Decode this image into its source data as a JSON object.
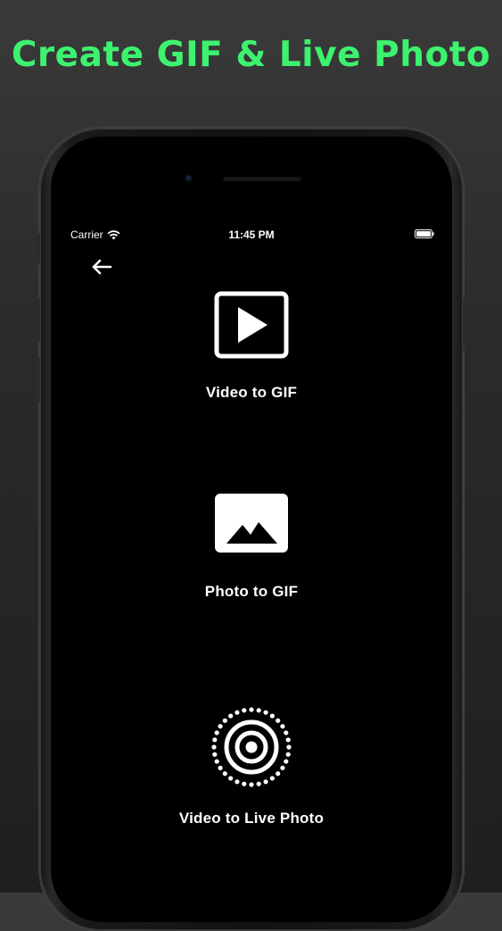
{
  "headline": "Create GIF & Live Photo",
  "status_bar": {
    "carrier": "Carrier",
    "time": "11:45 PM"
  },
  "options": [
    {
      "label": "Video to GIF",
      "icon": "video-play-icon"
    },
    {
      "label": "Photo to GIF",
      "icon": "photo-mountain-icon"
    },
    {
      "label": "Video to Live Photo",
      "icon": "live-photo-icon"
    }
  ],
  "colors": {
    "headline": "#3df26e",
    "screen_background": "#000000",
    "text": "#ffffff"
  }
}
